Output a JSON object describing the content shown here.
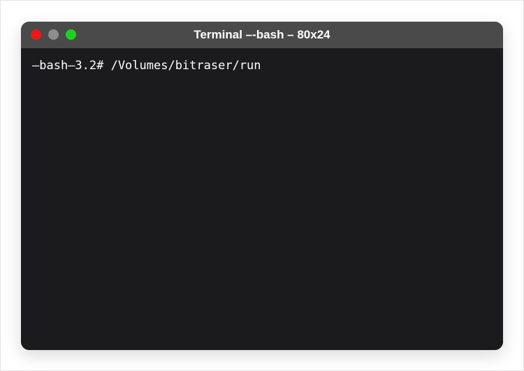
{
  "window": {
    "title": "Terminal –-bash – 80x24"
  },
  "traffic_lights": {
    "close_color": "#ec1818",
    "minimize_color": "#8d8d8d",
    "zoom_color": "#1fd01f"
  },
  "terminal": {
    "prompt": "–bash–3.2#",
    "command": "/Volumes/bitraser/run",
    "full_line": "–bash–3.2# /Volumes/bitraser/run"
  }
}
